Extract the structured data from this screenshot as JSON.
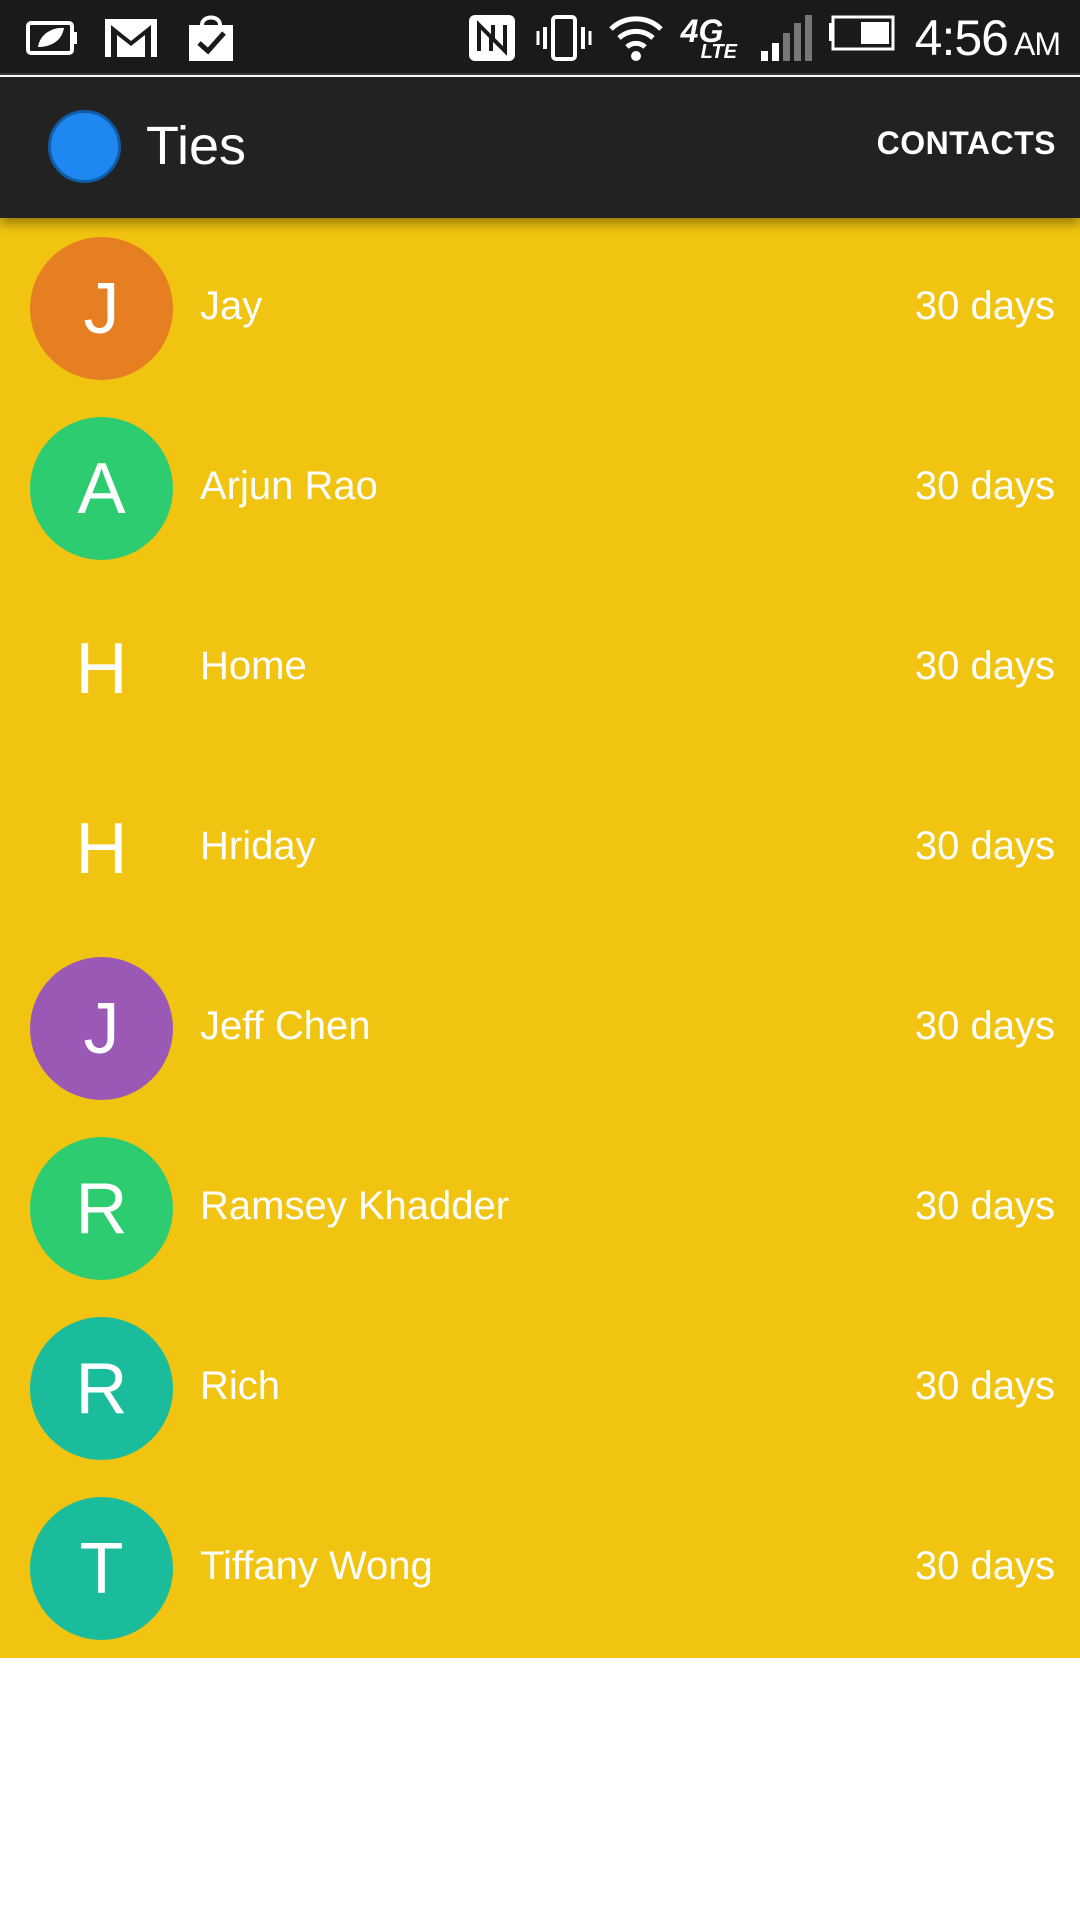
{
  "status_bar": {
    "left_icons": [
      "battery-saver-icon",
      "gmail-icon",
      "shopping-bag-check-icon"
    ],
    "right_icons": [
      "nfc-icon",
      "vibrate-icon",
      "wifi-icon",
      "4g-lte-icon",
      "signal-icon",
      "battery-icon"
    ],
    "network_label": "4G",
    "network_sub": "LTE",
    "time": "4:56",
    "ampm": "AM"
  },
  "app_bar": {
    "title": "Ties",
    "logo_color": "#1e88f0",
    "contacts_label": "CONTACTS"
  },
  "list": {
    "background": "#f0c410",
    "contacts": [
      {
        "initial": "J",
        "name": "Jay",
        "days": "30 days",
        "avatar_color": "#e67e22"
      },
      {
        "initial": "A",
        "name": "Arjun Rao",
        "days": "30 days",
        "avatar_color": "#2ecc71"
      },
      {
        "initial": "H",
        "name": "Home",
        "days": "30 days",
        "avatar_color": ""
      },
      {
        "initial": "H",
        "name": "Hriday",
        "days": "30 days",
        "avatar_color": ""
      },
      {
        "initial": "J",
        "name": "Jeff Chen",
        "days": "30 days",
        "avatar_color": "#9b59b6"
      },
      {
        "initial": "R",
        "name": "Ramsey Khadder",
        "days": "30 days",
        "avatar_color": "#2ecc71"
      },
      {
        "initial": "R",
        "name": "Rich",
        "days": "30 days",
        "avatar_color": "#1abc9c"
      },
      {
        "initial": "T",
        "name": "Tiffany Wong",
        "days": "30 days",
        "avatar_color": "#1abc9c"
      }
    ]
  }
}
